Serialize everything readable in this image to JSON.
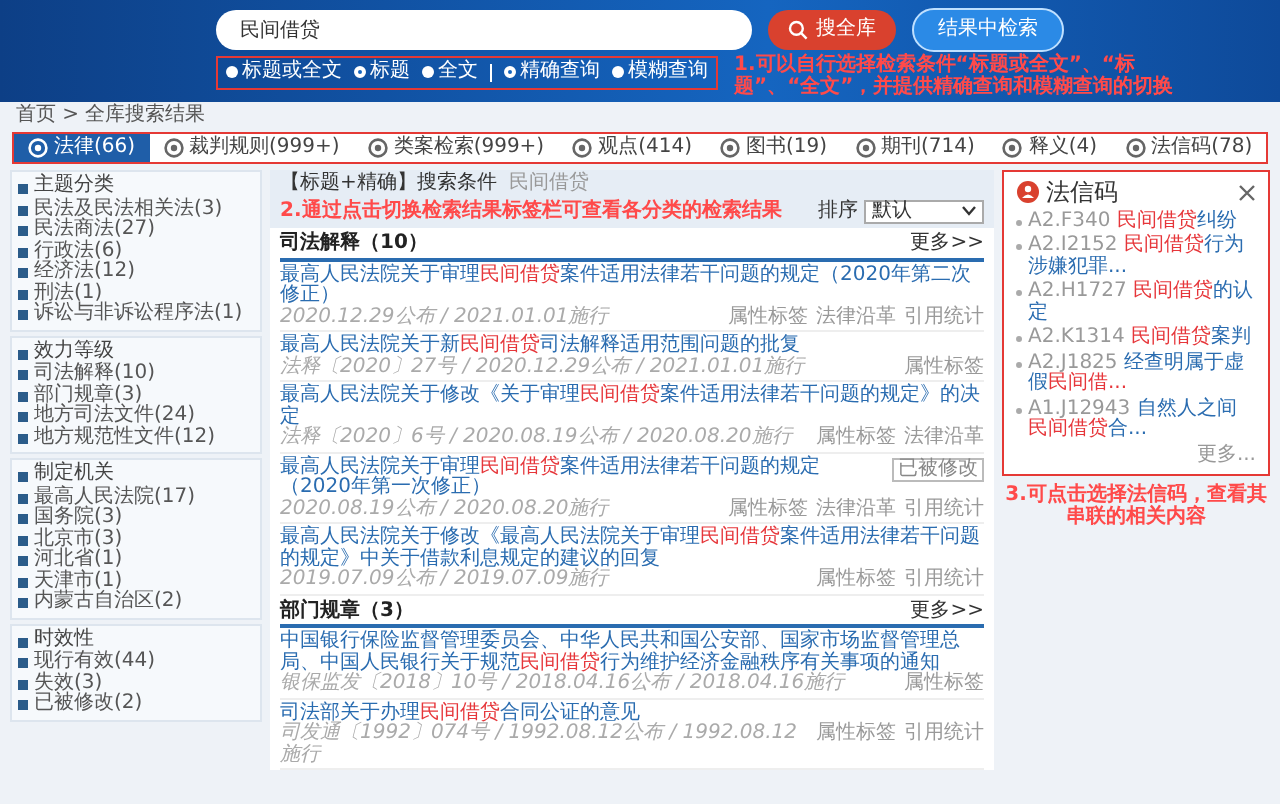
{
  "header": {
    "search": {
      "value": "民间借贷"
    },
    "buttons": [
      {
        "label": "搜全库",
        "kind": "primary"
      },
      {
        "label": "结果中检索",
        "kind": "secondary"
      }
    ],
    "scope_options": [
      {
        "label": "标题或全文",
        "selected": false
      },
      {
        "label": "标题",
        "selected": true
      },
      {
        "label": "全文",
        "selected": false
      }
    ],
    "match_options": [
      {
        "label": "精确查询",
        "selected": true
      },
      {
        "label": "模糊查询",
        "selected": false
      }
    ],
    "annotation": "1.可以自行选择检索条件“标题或全文”、“标题”、“全文”，并提供精确查询和模糊查询的切换"
  },
  "breadcrumb": "首页 > 全库搜索结果",
  "tabs": [
    {
      "label": "法律(66)",
      "selected": true
    },
    {
      "label": "裁判规则(999+)",
      "selected": false
    },
    {
      "label": "类案检索(999+)",
      "selected": false
    },
    {
      "label": "观点(414)",
      "selected": false
    },
    {
      "label": "图书(19)",
      "selected": false
    },
    {
      "label": "期刊(714)",
      "selected": false
    },
    {
      "label": "释义(4)",
      "selected": false
    },
    {
      "label": "法信码(78)",
      "selected": false
    }
  ],
  "sidebar": {
    "groups": [
      {
        "title": "主题分类",
        "items": [
          "民法及民法相关法(3)",
          "民法商法(27)",
          "行政法(6)",
          "经济法(12)",
          "刑法(1)",
          "诉讼与非诉讼程序法(1)"
        ]
      },
      {
        "title": "效力等级",
        "items": [
          "司法解释(10)",
          "部门规章(3)",
          "地方司法文件(24)",
          "地方规范性文件(12)"
        ]
      },
      {
        "title": "制定机关",
        "items": [
          "最高人民法院(17)",
          "国务院(3)",
          "北京市(3)",
          "河北省(1)",
          "天津市(1)",
          "内蒙古自治区(2)"
        ]
      },
      {
        "title": "时效性",
        "items": [
          "现行有效(44)",
          "失效(3)",
          "已被修改(2)"
        ]
      }
    ]
  },
  "results": {
    "condition_label": "【标题+精确】搜索条件",
    "condition_value": "民间借贷",
    "annotation": "2.通过点击切换检索结果标签栏可查看各分类的检索结果",
    "sort_label": "排序",
    "sort_value": "默认",
    "sections": [
      {
        "title": "司法解释（10）",
        "more": "更多>>",
        "items": [
          {
            "title": [
              {
                "text": "最高人民法院关于审理",
                "highlight": false
              },
              {
                "text": "民间借贷",
                "highlight": true
              },
              {
                "text": "案件适用法律若干问题的规定（2020年第二次修正）",
                "highlight": false
              }
            ],
            "meta": "2020.12.29公布 / 2021.01.01施行",
            "tags": [
              "属性标签",
              "法律沿革",
              "引用统计"
            ]
          },
          {
            "title": [
              {
                "text": "最高人民法院关于新",
                "highlight": false
              },
              {
                "text": "民间借贷",
                "highlight": true
              },
              {
                "text": "司法解释适用范围问题的批复",
                "highlight": false
              }
            ],
            "meta": "法释〔2020〕27号 / 2020.12.29公布 / 2021.01.01施行",
            "tags": [
              "属性标签"
            ]
          },
          {
            "title": [
              {
                "text": "最高人民法院关于修改《关于审理",
                "highlight": false
              },
              {
                "text": "民间借贷",
                "highlight": true
              },
              {
                "text": "案件适用法律若干问题的规定》的决定",
                "highlight": false
              }
            ],
            "meta": "法释〔2020〕6号 / 2020.08.19公布 / 2020.08.20施行",
            "tags": [
              "属性标签",
              "法律沿革"
            ]
          },
          {
            "title": [
              {
                "text": "最高人民法院关于审理",
                "highlight": false
              },
              {
                "text": "民间借贷",
                "highlight": true
              },
              {
                "text": "案件适用法律若干问题的规定（2020年第一次修正）",
                "highlight": false
              }
            ],
            "meta": "2020.08.19公布 / 2020.08.20施行",
            "tags": [
              "属性标签",
              "法律沿革",
              "引用统计"
            ],
            "stamp": "已被修改"
          },
          {
            "title": [
              {
                "text": "最高人民法院关于修改《最高人民法院关于审理",
                "highlight": false
              },
              {
                "text": "民间借贷",
                "highlight": true
              },
              {
                "text": "案件适用法律若干问题的规定》中关于借款利息规定的建议的回复",
                "highlight": false
              }
            ],
            "meta": "2019.07.09公布 / 2019.07.09施行",
            "tags": [
              "属性标签",
              "引用统计"
            ]
          }
        ]
      },
      {
        "title": "部门规章（3）",
        "more": "更多>>",
        "items": [
          {
            "title": [
              {
                "text": "中国银行保险监督管理委员会、中华人民共和国公安部、国家市场监督管理总局、中国人民银行关于规范",
                "highlight": false
              },
              {
                "text": "民间借贷",
                "highlight": true
              },
              {
                "text": "行为维护经济金融秩序有关事项的通知",
                "highlight": false
              }
            ],
            "meta": "银保监发〔2018〕10号 / 2018.04.16公布 / 2018.04.16施行",
            "tags": [
              "属性标签"
            ]
          },
          {
            "title": [
              {
                "text": "司法部关于办理",
                "highlight": false
              },
              {
                "text": "民间借贷",
                "highlight": true
              },
              {
                "text": "合同公证的意见",
                "highlight": false
              }
            ],
            "meta": "司发通〔1992〕074号 / 1992.08.12公布 / 1992.08.12施行",
            "tags": [
              "属性标签",
              "引用统计"
            ]
          }
        ]
      }
    ]
  },
  "faxinma": {
    "title": "法信码",
    "more": "更多...",
    "annotation": "3.可点击选择法信码，查看其串联的相关内容",
    "items": [
      {
        "code": "A2.F340",
        "text": [
          {
            "text": "民间借贷",
            "highlight": true
          },
          {
            "text": "纠纷",
            "highlight": false
          }
        ]
      },
      {
        "code": "A2.I2152",
        "text": [
          {
            "text": "民间借贷",
            "highlight": true
          },
          {
            "text": "行为涉嫌犯罪...",
            "highlight": false
          }
        ]
      },
      {
        "code": "A2.H1727",
        "text": [
          {
            "text": "民间借贷",
            "highlight": true
          },
          {
            "text": "的认定",
            "highlight": false
          }
        ]
      },
      {
        "code": "A2.K1314",
        "text": [
          {
            "text": "民间借贷",
            "highlight": true
          },
          {
            "text": "案判",
            "highlight": false
          }
        ]
      },
      {
        "code": "A2.J1825",
        "text": [
          {
            "text": "经查明属于虚假",
            "highlight": false
          },
          {
            "text": "民间借...",
            "highlight": true
          }
        ]
      },
      {
        "code": "A1.J12943",
        "text": [
          {
            "text": "自然人之间",
            "highlight": false
          },
          {
            "text": "民间借贷",
            "highlight": true
          },
          {
            "text": "合...",
            "highlight": false
          }
        ]
      }
    ]
  }
}
